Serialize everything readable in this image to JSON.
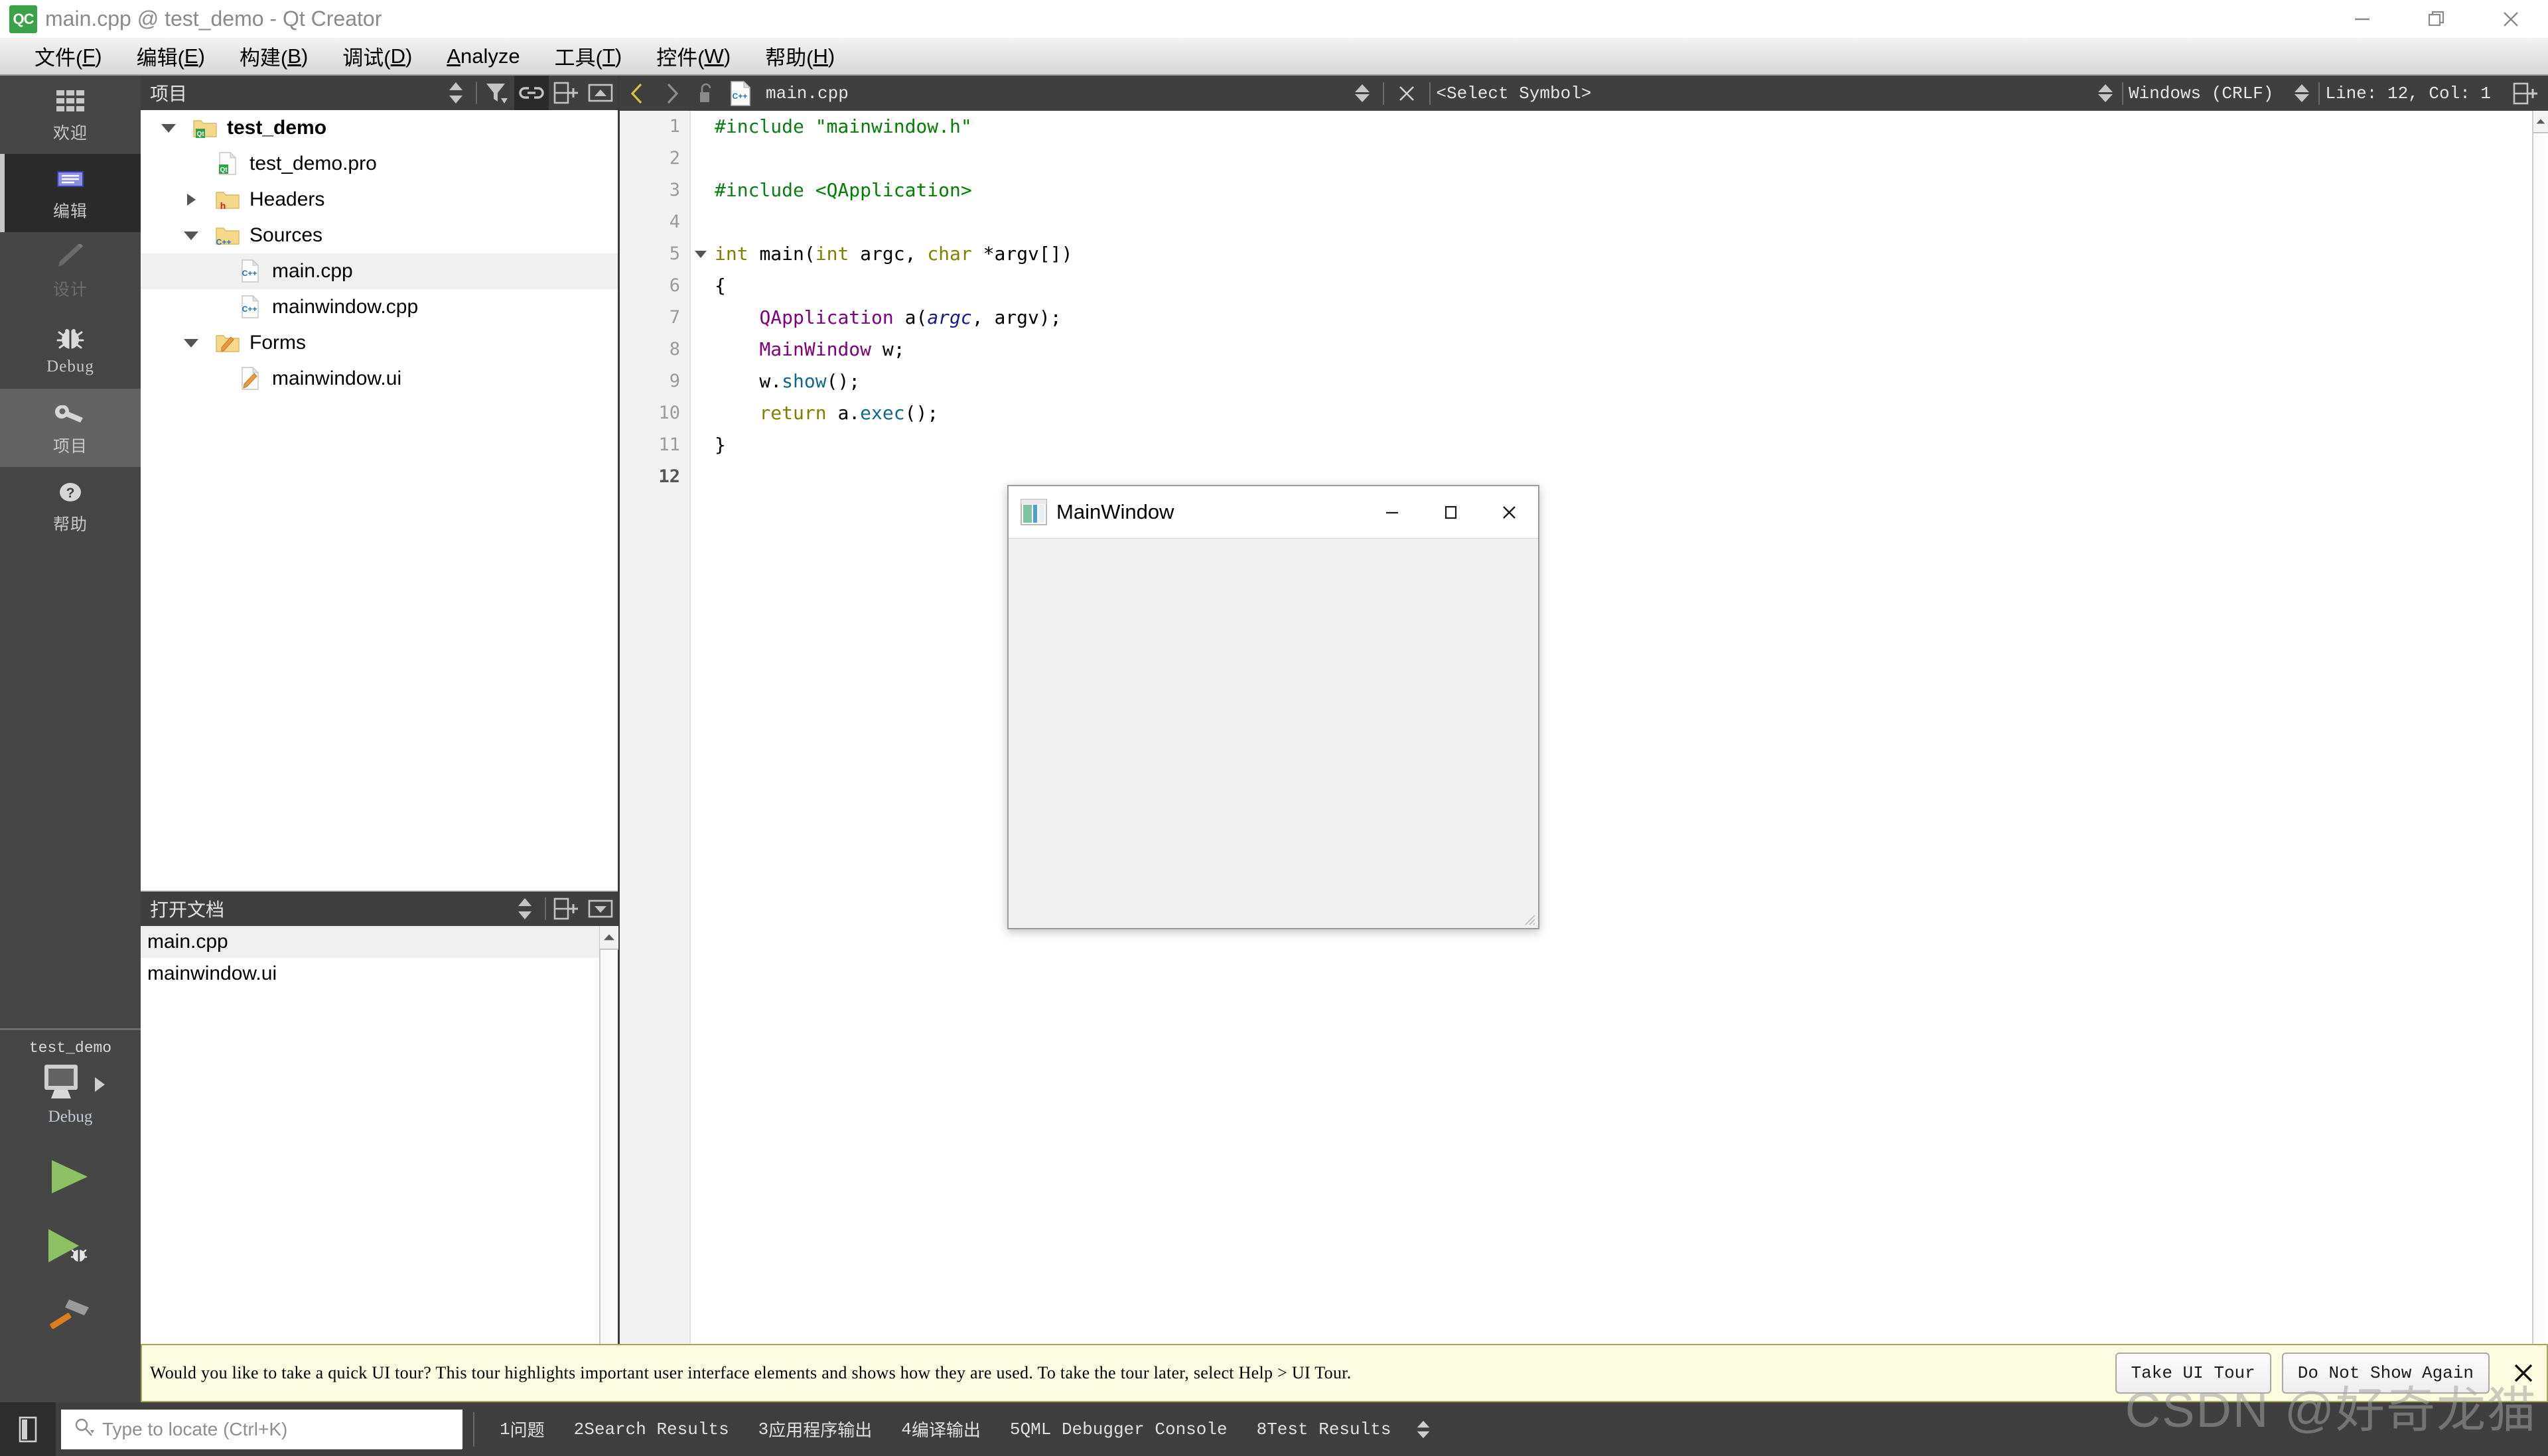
{
  "window": {
    "title": "main.cpp @ test_demo - Qt Creator",
    "app_badge": "QC",
    "controls": {
      "minimize": "minimize-icon",
      "restore": "restore-icon",
      "close": "close-icon"
    }
  },
  "menubar": {
    "items": [
      {
        "label": "文件(F)",
        "mnemonic": "F"
      },
      {
        "label": "编辑(E)",
        "mnemonic": "E"
      },
      {
        "label": "构建(B)",
        "mnemonic": "B"
      },
      {
        "label": "调试(D)",
        "mnemonic": "D"
      },
      {
        "label": "Analyze",
        "mnemonic": "A"
      },
      {
        "label": "工具(T)",
        "mnemonic": "T"
      },
      {
        "label": "控件(W)",
        "mnemonic": "W"
      },
      {
        "label": "帮助(H)",
        "mnemonic": "H"
      }
    ]
  },
  "moderail": {
    "items": [
      {
        "label": "欢迎",
        "icon": "grid-icon",
        "state": "normal"
      },
      {
        "label": "编辑",
        "icon": "editor-icon",
        "state": "active"
      },
      {
        "label": "设计",
        "icon": "pencil-icon",
        "state": "disabled"
      },
      {
        "label": "Debug",
        "icon": "bug-icon",
        "state": "normal"
      },
      {
        "label": "项目",
        "icon": "wrench-icon",
        "state": "hover"
      },
      {
        "label": "帮助",
        "icon": "question-icon",
        "state": "normal"
      }
    ],
    "kit": {
      "project_name": "test_demo",
      "target_icon": "desktop-icon",
      "expand_icon": "chevron-right-icon",
      "build_config": "Debug"
    },
    "actions": [
      {
        "name": "run-button",
        "icon": "play-icon"
      },
      {
        "name": "debug-button",
        "icon": "play-bug-icon"
      },
      {
        "name": "build-button",
        "icon": "hammer-icon"
      }
    ]
  },
  "project_panel": {
    "title": "项目",
    "tools": [
      {
        "name": "sync-spinner",
        "icon": "spin-arrows-icon",
        "selected": false
      },
      {
        "name": "filter-button",
        "icon": "funnel-icon",
        "selected": false
      },
      {
        "name": "link-button",
        "icon": "link-icon",
        "selected": true
      },
      {
        "name": "split-button",
        "icon": "split-plus-icon",
        "selected": false
      },
      {
        "name": "close-split-button",
        "icon": "collapse-icon",
        "selected": false
      }
    ],
    "tree": [
      {
        "label": "test_demo",
        "indent": 0,
        "twisty": "down",
        "icon": "qt-folder-icon",
        "bold": true,
        "selected": false
      },
      {
        "label": "test_demo.pro",
        "indent": 1,
        "twisty": "none",
        "icon": "qt-pro-file-icon",
        "bold": false,
        "selected": false
      },
      {
        "label": "Headers",
        "indent": 1,
        "twisty": "right",
        "icon": "h-folder-icon",
        "bold": false,
        "selected": false
      },
      {
        "label": "Sources",
        "indent": 1,
        "twisty": "down",
        "icon": "cpp-folder-icon",
        "bold": false,
        "selected": false
      },
      {
        "label": "main.cpp",
        "indent": 2,
        "twisty": "none",
        "icon": "cpp-file-icon",
        "bold": false,
        "selected": true
      },
      {
        "label": "mainwindow.cpp",
        "indent": 2,
        "twisty": "none",
        "icon": "cpp-file-icon",
        "bold": false,
        "selected": false
      },
      {
        "label": "Forms",
        "indent": 1,
        "twisty": "down",
        "icon": "ui-folder-icon",
        "bold": false,
        "selected": false
      },
      {
        "label": "mainwindow.ui",
        "indent": 2,
        "twisty": "none",
        "icon": "ui-file-icon",
        "bold": false,
        "selected": false
      }
    ]
  },
  "opendocs_panel": {
    "title": "打开文档",
    "tools": [
      {
        "name": "sync-spinner",
        "icon": "spin-arrows-icon"
      },
      {
        "name": "split-button",
        "icon": "split-plus-icon"
      },
      {
        "name": "dropdown-button",
        "icon": "collapse-down-icon"
      }
    ],
    "items": [
      {
        "label": "main.cpp",
        "selected": true
      },
      {
        "label": "mainwindow.ui",
        "selected": false
      }
    ]
  },
  "editor_toolbar": {
    "nav_back": "chevron-left-icon",
    "nav_forward": "chevron-right-icon",
    "lock_icon": "unlocked-icon",
    "file_icon": "cpp-file-icon",
    "file_name": "main.cpp",
    "file_spinner": "spin-arrows-icon",
    "close_icon": "close-x-icon",
    "symbol_selector": "<Select Symbol>",
    "symbol_spinner": "spin-arrows-icon",
    "line_ending": "Windows (CRLF)",
    "line_ending_spinner": "spin-arrows-icon",
    "cursor_position": "Line: 12, Col: 1",
    "split_icon": "split-plus-icon"
  },
  "code": {
    "current_line": 12,
    "fold_line": 5,
    "lines": [
      {
        "n": 1,
        "tokens": [
          {
            "t": "#include ",
            "c": "k-pre"
          },
          {
            "t": "\"mainwindow.h\"",
            "c": "k-inc"
          }
        ]
      },
      {
        "n": 2,
        "tokens": []
      },
      {
        "n": 3,
        "tokens": [
          {
            "t": "#include ",
            "c": "k-pre"
          },
          {
            "t": "<QApplication>",
            "c": "k-inc"
          }
        ]
      },
      {
        "n": 4,
        "tokens": []
      },
      {
        "n": 5,
        "tokens": [
          {
            "t": "int",
            "c": "k-kw"
          },
          {
            "t": " ",
            "c": "k-op"
          },
          {
            "t": "main",
            "c": "k-pl"
          },
          {
            "t": "(",
            "c": "k-op"
          },
          {
            "t": "int",
            "c": "k-kw"
          },
          {
            "t": " argc, ",
            "c": "k-op"
          },
          {
            "t": "char",
            "c": "k-kw"
          },
          {
            "t": " *argv[])",
            "c": "k-op"
          }
        ]
      },
      {
        "n": 6,
        "tokens": [
          {
            "t": "{",
            "c": "k-op"
          }
        ]
      },
      {
        "n": 7,
        "tokens": [
          {
            "t": "    ",
            "c": "k-op"
          },
          {
            "t": "QApplication",
            "c": "k-typ"
          },
          {
            "t": " a(",
            "c": "k-op"
          },
          {
            "t": "argc",
            "c": "k-par"
          },
          {
            "t": ", argv);",
            "c": "k-op"
          }
        ]
      },
      {
        "n": 8,
        "tokens": [
          {
            "t": "    ",
            "c": "k-op"
          },
          {
            "t": "MainWindow",
            "c": "k-typ"
          },
          {
            "t": " w;",
            "c": "k-op"
          }
        ]
      },
      {
        "n": 9,
        "tokens": [
          {
            "t": "    w.",
            "c": "k-op"
          },
          {
            "t": "show",
            "c": "k-mem"
          },
          {
            "t": "();",
            "c": "k-op"
          }
        ]
      },
      {
        "n": 10,
        "tokens": [
          {
            "t": "    ",
            "c": "k-op"
          },
          {
            "t": "return",
            "c": "k-kw"
          },
          {
            "t": " a.",
            "c": "k-op"
          },
          {
            "t": "exec",
            "c": "k-mem"
          },
          {
            "t": "();",
            "c": "k-op"
          }
        ]
      },
      {
        "n": 11,
        "tokens": [
          {
            "t": "}",
            "c": "k-op"
          }
        ]
      },
      {
        "n": 12,
        "tokens": []
      }
    ]
  },
  "mainwindow_popup": {
    "title": "MainWindow",
    "icon": "qt-window-icon",
    "minimize": "minimize-icon",
    "maximize": "maximize-icon",
    "close": "close-icon"
  },
  "tour_bar": {
    "message": "Would you like to take a quick UI tour? This tour highlights important user interface elements and shows how they are used. To take the tour later, select Help > UI Tour.",
    "take_tour_label": "Take UI Tour",
    "dismiss_label": "Do Not Show Again",
    "close_icon": "close-x-icon"
  },
  "statusbar": {
    "sidebar_toggle_icon": "sidebar-toggle-icon",
    "search": {
      "icon": "search-icon",
      "placeholder": "Type to locate (Ctrl+K)",
      "value": ""
    },
    "panes": [
      {
        "num": "1",
        "label": "问题",
        "cjk": true
      },
      {
        "num": "2",
        "label": "Search Results",
        "cjk": false
      },
      {
        "num": "3",
        "label": "应用程序输出",
        "cjk": true
      },
      {
        "num": "4",
        "label": "编译输出",
        "cjk": true
      },
      {
        "num": "5",
        "label": "QML Debugger Console",
        "cjk": false
      },
      {
        "num": "8",
        "label": "Test Results",
        "cjk": false
      }
    ],
    "spinner_icon": "spin-arrows-icon"
  },
  "watermark": {
    "text": "CSDN @好奇龙猫"
  },
  "colors": {
    "accent_green": "#3aa34a",
    "panel_dark": "#3f3f3f",
    "rail_dark": "#464646",
    "rail_active": "#2b2b2b",
    "tour_bg": "#fbfbe0",
    "selection": "#f0f0f0"
  }
}
